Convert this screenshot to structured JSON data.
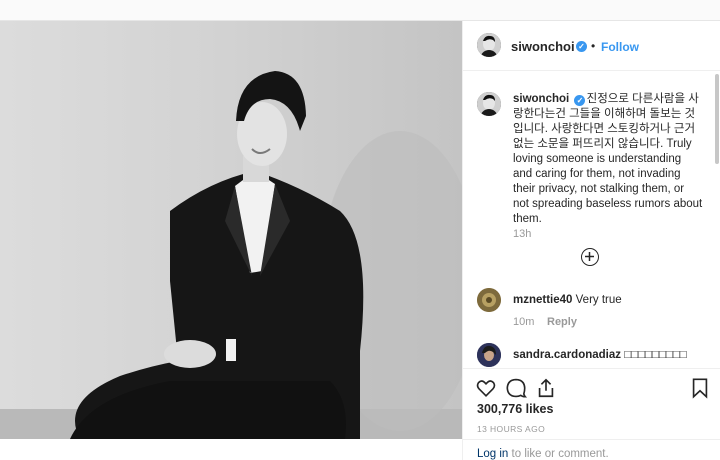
{
  "post": {
    "username": "siwonchoi",
    "follow_label": "Follow",
    "separator": "•",
    "verified_mark": "✓"
  },
  "caption": {
    "username": "siwonchoi",
    "text": "진정으로 다른사람을 사랑한다는건 그들을 이해하며 돌보는 것입니다. 사랑한다면 스토킹하거나 근거없는 소문을 퍼뜨리지 않습니다. Truly loving someone is understanding and caring for them, not invading their privacy, not stalking them, or not spreading baseless rumors about them.",
    "time": "13h"
  },
  "comments": [
    {
      "username": "mznettie40",
      "text": "Very true",
      "time": "10m",
      "reply_label": "Reply"
    },
    {
      "username": "sandra.cardonadiaz",
      "text": "□□□□□□□□□",
      "time": "",
      "reply_label": ""
    }
  ],
  "actions": {
    "likes": "300,776 likes",
    "ago": "13 HOURS AGO",
    "icons": [
      "heart-icon",
      "comment-icon",
      "share-icon",
      "bookmark-icon"
    ]
  },
  "login": {
    "link": "Log in",
    "rest": " to like or comment."
  },
  "colors": {
    "link_blue": "#3897f0",
    "muted": "#999999",
    "border": "#efefef"
  }
}
